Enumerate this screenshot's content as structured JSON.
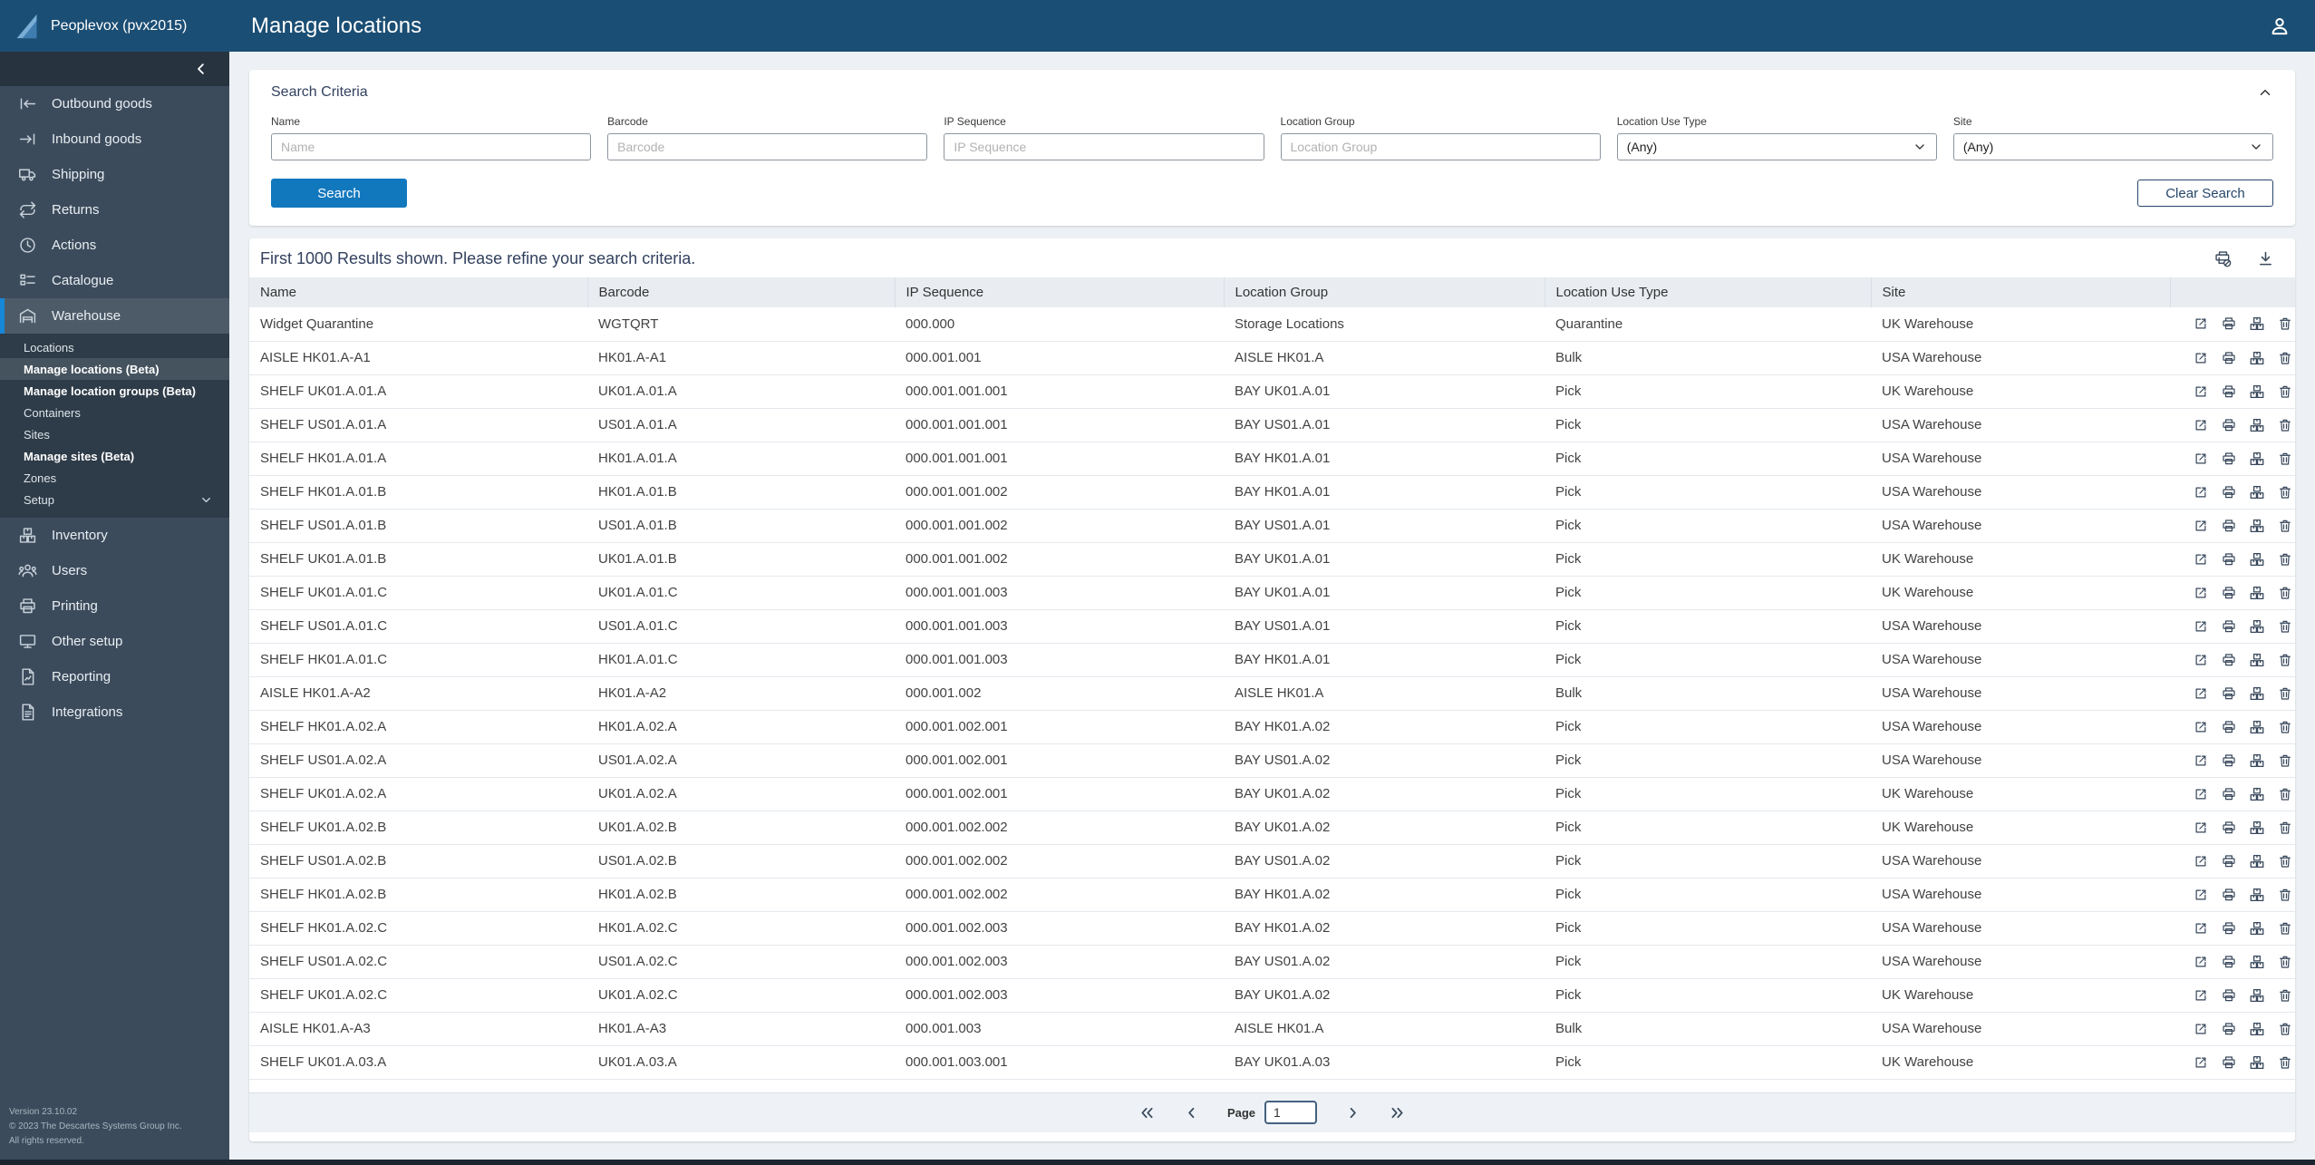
{
  "colors": {
    "header_bg": "#1b4e74",
    "sidebar_bg": "#3c4b5c",
    "accent_blue": "#1787d8",
    "search_button_bg": "#1278be",
    "content_bg": "#edf1f5"
  },
  "header": {
    "brand": "Peoplevox (pvx2015)",
    "title": "Manage locations",
    "user_icon": "person-icon"
  },
  "sidebar": {
    "collapse_icon": "chevron-left-icon",
    "items": [
      {
        "label": "Outbound goods",
        "icon": "outbound",
        "active": false
      },
      {
        "label": "Inbound goods",
        "icon": "inbound",
        "active": false
      },
      {
        "label": "Shipping",
        "icon": "shipping",
        "active": false
      },
      {
        "label": "Returns",
        "icon": "returns",
        "active": false
      },
      {
        "label": "Actions",
        "icon": "actions",
        "active": false
      },
      {
        "label": "Catalogue",
        "icon": "catalogue",
        "active": false
      },
      {
        "label": "Warehouse",
        "icon": "warehouse",
        "active": true,
        "submenu": [
          {
            "label": "Locations",
            "bold": false,
            "active": false
          },
          {
            "label": "Manage locations (Beta)",
            "bold": true,
            "active": true
          },
          {
            "label": "Manage location groups (Beta)",
            "bold": true,
            "active": false
          },
          {
            "label": "Containers",
            "bold": false,
            "active": false
          },
          {
            "label": "Sites",
            "bold": false,
            "active": false
          },
          {
            "label": "Manage sites (Beta)",
            "bold": true,
            "active": false
          },
          {
            "label": "Zones",
            "bold": false,
            "active": false
          },
          {
            "label": "Setup",
            "bold": false,
            "active": false,
            "chevron": true
          }
        ]
      },
      {
        "label": "Inventory",
        "icon": "inventory",
        "active": false
      },
      {
        "label": "Users",
        "icon": "users",
        "active": false
      },
      {
        "label": "Printing",
        "icon": "printing",
        "active": false
      },
      {
        "label": "Other setup",
        "icon": "othersetup",
        "active": false
      },
      {
        "label": "Reporting",
        "icon": "reporting",
        "active": false
      },
      {
        "label": "Integrations",
        "icon": "integrations",
        "active": false
      }
    ],
    "footer": {
      "line1": "Version 23.10.02",
      "line2": "© 2023 The Descartes Systems Group Inc.",
      "line3": "All rights reserved."
    }
  },
  "search": {
    "title": "Search Criteria",
    "collapse_icon": "chevron-up-icon",
    "fields": [
      {
        "label": "Name",
        "type": "text",
        "placeholder": "Name",
        "value": ""
      },
      {
        "label": "Barcode",
        "type": "text",
        "placeholder": "Barcode",
        "value": ""
      },
      {
        "label": "IP Sequence",
        "type": "text",
        "placeholder": "IP Sequence",
        "value": ""
      },
      {
        "label": "Location Group",
        "type": "text",
        "placeholder": "Location Group",
        "value": ""
      },
      {
        "label": "Location Use Type",
        "type": "select",
        "value": "(Any)"
      },
      {
        "label": "Site",
        "type": "select",
        "value": "(Any)"
      }
    ],
    "search_button": "Search",
    "clear_button": "Clear Search"
  },
  "results": {
    "message": "First 1000 Results shown. Please refine your search criteria.",
    "header_icons": [
      "print-disabled",
      "download"
    ],
    "columns": [
      "Name",
      "Barcode",
      "IP Sequence",
      "Location Group",
      "Location Use Type",
      "Site"
    ],
    "row_actions": [
      "edit",
      "print",
      "inventory",
      "delete"
    ],
    "rows": [
      [
        "Widget Quarantine",
        "WGTQRT",
        "000.000",
        "Storage Locations",
        "Quarantine",
        "UK Warehouse"
      ],
      [
        "AISLE HK01.A-A1",
        "HK01.A-A1",
        "000.001.001",
        "AISLE HK01.A",
        "Bulk",
        "USA Warehouse"
      ],
      [
        "SHELF UK01.A.01.A",
        "UK01.A.01.A",
        "000.001.001.001",
        "BAY UK01.A.01",
        "Pick",
        "UK Warehouse"
      ],
      [
        "SHELF US01.A.01.A",
        "US01.A.01.A",
        "000.001.001.001",
        "BAY US01.A.01",
        "Pick",
        "USA Warehouse"
      ],
      [
        "SHELF HK01.A.01.A",
        "HK01.A.01.A",
        "000.001.001.001",
        "BAY HK01.A.01",
        "Pick",
        "USA Warehouse"
      ],
      [
        "SHELF HK01.A.01.B",
        "HK01.A.01.B",
        "000.001.001.002",
        "BAY HK01.A.01",
        "Pick",
        "USA Warehouse"
      ],
      [
        "SHELF US01.A.01.B",
        "US01.A.01.B",
        "000.001.001.002",
        "BAY US01.A.01",
        "Pick",
        "USA Warehouse"
      ],
      [
        "SHELF UK01.A.01.B",
        "UK01.A.01.B",
        "000.001.001.002",
        "BAY UK01.A.01",
        "Pick",
        "UK Warehouse"
      ],
      [
        "SHELF UK01.A.01.C",
        "UK01.A.01.C",
        "000.001.001.003",
        "BAY UK01.A.01",
        "Pick",
        "UK Warehouse"
      ],
      [
        "SHELF US01.A.01.C",
        "US01.A.01.C",
        "000.001.001.003",
        "BAY US01.A.01",
        "Pick",
        "USA Warehouse"
      ],
      [
        "SHELF HK01.A.01.C",
        "HK01.A.01.C",
        "000.001.001.003",
        "BAY HK01.A.01",
        "Pick",
        "USA Warehouse"
      ],
      [
        "AISLE HK01.A-A2",
        "HK01.A-A2",
        "000.001.002",
        "AISLE HK01.A",
        "Bulk",
        "USA Warehouse"
      ],
      [
        "SHELF HK01.A.02.A",
        "HK01.A.02.A",
        "000.001.002.001",
        "BAY HK01.A.02",
        "Pick",
        "USA Warehouse"
      ],
      [
        "SHELF US01.A.02.A",
        "US01.A.02.A",
        "000.001.002.001",
        "BAY US01.A.02",
        "Pick",
        "USA Warehouse"
      ],
      [
        "SHELF UK01.A.02.A",
        "UK01.A.02.A",
        "000.001.002.001",
        "BAY UK01.A.02",
        "Pick",
        "UK Warehouse"
      ],
      [
        "SHELF UK01.A.02.B",
        "UK01.A.02.B",
        "000.001.002.002",
        "BAY UK01.A.02",
        "Pick",
        "UK Warehouse"
      ],
      [
        "SHELF US01.A.02.B",
        "US01.A.02.B",
        "000.001.002.002",
        "BAY US01.A.02",
        "Pick",
        "USA Warehouse"
      ],
      [
        "SHELF HK01.A.02.B",
        "HK01.A.02.B",
        "000.001.002.002",
        "BAY HK01.A.02",
        "Pick",
        "USA Warehouse"
      ],
      [
        "SHELF HK01.A.02.C",
        "HK01.A.02.C",
        "000.001.002.003",
        "BAY HK01.A.02",
        "Pick",
        "USA Warehouse"
      ],
      [
        "SHELF US01.A.02.C",
        "US01.A.02.C",
        "000.001.002.003",
        "BAY US01.A.02",
        "Pick",
        "USA Warehouse"
      ],
      [
        "SHELF UK01.A.02.C",
        "UK01.A.02.C",
        "000.001.002.003",
        "BAY UK01.A.02",
        "Pick",
        "UK Warehouse"
      ],
      [
        "AISLE HK01.A-A3",
        "HK01.A-A3",
        "000.001.003",
        "AISLE HK01.A",
        "Bulk",
        "USA Warehouse"
      ],
      [
        "SHELF UK01.A.03.A",
        "UK01.A.03.A",
        "000.001.003.001",
        "BAY UK01.A.03",
        "Pick",
        "UK Warehouse"
      ]
    ]
  },
  "pagination": {
    "first_icon": "page-first",
    "prev_icon": "page-prev",
    "label": "Page",
    "value": "1",
    "next_icon": "page-next",
    "last_icon": "page-last"
  }
}
